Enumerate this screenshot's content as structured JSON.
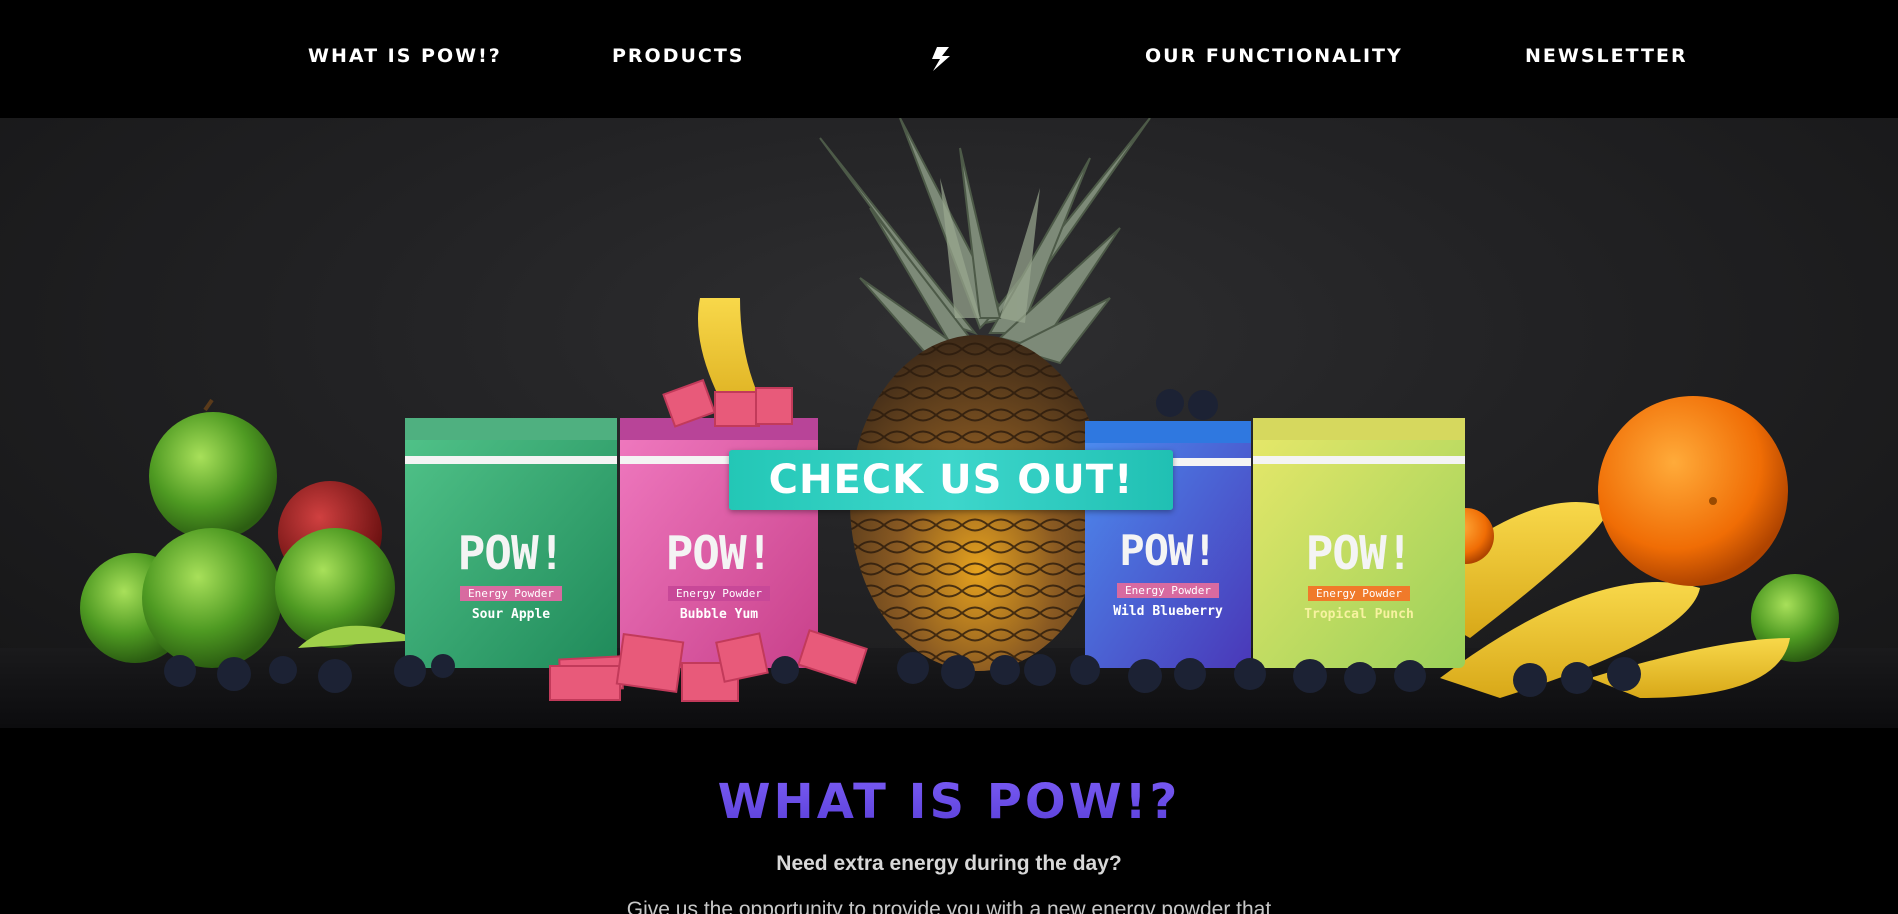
{
  "nav": {
    "links": [
      "WHAT IS POW!?",
      "PRODUCTS",
      "OUR FUNCTIONALITY",
      "NEWSLETTER"
    ],
    "brand": "POW!",
    "brand_icon": "lightning-bolt-icon"
  },
  "hero": {
    "cta_label": "CHECK US OUT!",
    "products": [
      {
        "name": "Sour Apple",
        "label": "Energy Powder",
        "brand": "POW!",
        "color": "#2fa56e"
      },
      {
        "name": "Bubble Yum",
        "label": "Energy Powder",
        "brand": "POW!",
        "color": "#e060a8"
      },
      {
        "name": "Wild Blueberry",
        "label": "Energy Powder",
        "brand": "POW!",
        "color": "#3a66d8"
      },
      {
        "name": "Tropical Punch",
        "label": "Energy Powder",
        "brand": "POW!",
        "color": "#c8dc5a"
      }
    ]
  },
  "about": {
    "title": "WHAT IS POW!?",
    "subtitle": "Need extra energy during the day?",
    "body": "Give us the opportunity to provide you with a new energy powder that"
  },
  "colors": {
    "accent": "#2ac9bb",
    "heading": "#6b4fe8",
    "background": "#000000"
  }
}
